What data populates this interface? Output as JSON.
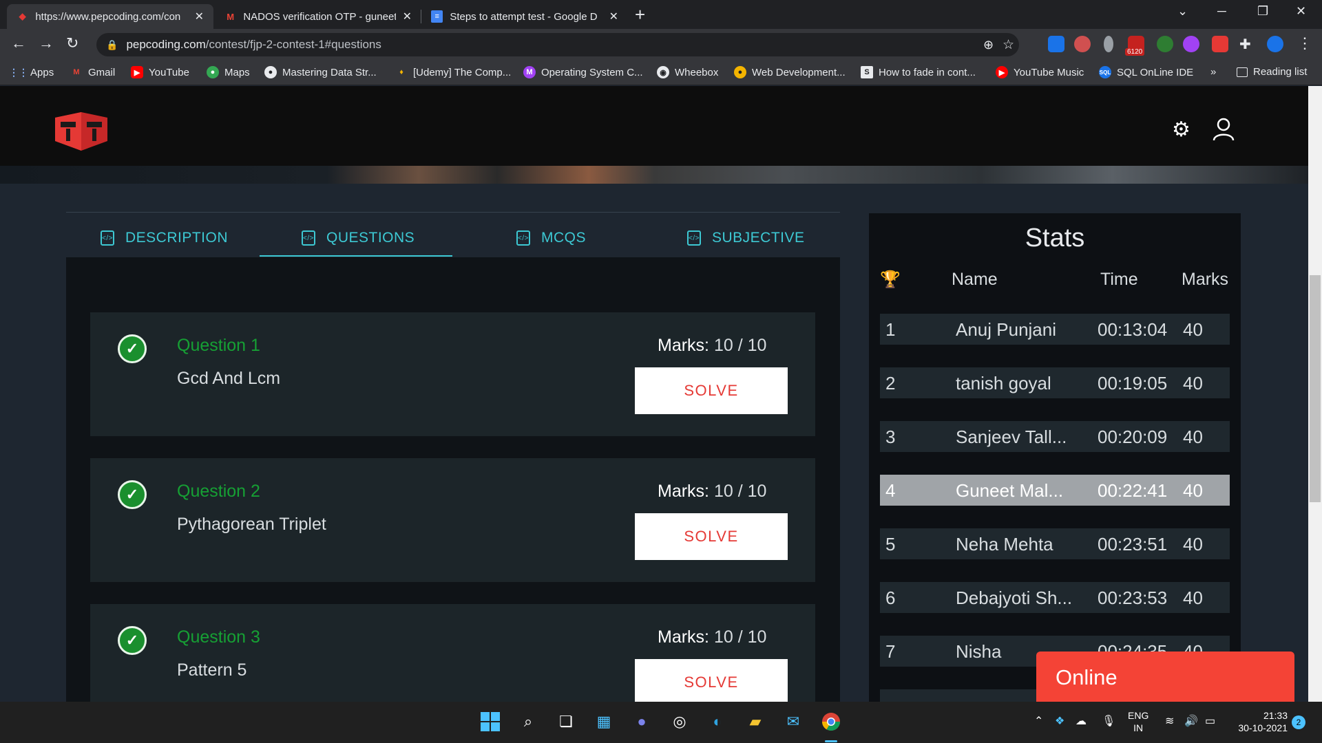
{
  "browser": {
    "tabs": [
      {
        "title": "https://www.pepcoding.com/con",
        "active": true
      },
      {
        "title": "NADOS verification OTP - guneet",
        "active": false
      },
      {
        "title": "Steps to attempt test - Google D",
        "active": false
      }
    ],
    "url_host": "pepcoding.com",
    "url_path": "/contest/fjp-2-contest-1#questions",
    "extension_badge": "6120",
    "bookmarks": [
      "Apps",
      "Gmail",
      "YouTube",
      "Maps",
      "Mastering Data Str...",
      "[Udemy] The Comp...",
      "Operating System C...",
      "Wheebox",
      "Web Development...",
      "How to fade in cont...",
      "YouTube Music",
      "SQL OnLine IDE",
      "»",
      "Reading list"
    ]
  },
  "nav_tabs": [
    "DESCRIPTION",
    "QUESTIONS",
    "MCQS",
    "SUBJECTIVE"
  ],
  "questions": [
    {
      "title": "Question 1",
      "name": "Gcd And Lcm",
      "marks_label": "Marks:",
      "marks": "10 / 10",
      "button": "SOLVE"
    },
    {
      "title": "Question 2",
      "name": "Pythagorean Triplet",
      "marks_label": "Marks:",
      "marks": "10 / 10",
      "button": "SOLVE"
    },
    {
      "title": "Question 3",
      "name": "Pattern 5",
      "marks_label": "Marks:",
      "marks": "10 / 10",
      "button": "SOLVE"
    }
  ],
  "stats": {
    "title": "Stats",
    "headers": {
      "name": "Name",
      "time": "Time",
      "marks": "Marks"
    },
    "rows": [
      {
        "rank": "1",
        "name": "Anuj Punjani",
        "time": "00:13:04",
        "marks": "40",
        "highlight": false
      },
      {
        "rank": "2",
        "name": "tanish goyal",
        "time": "00:19:05",
        "marks": "40",
        "highlight": false
      },
      {
        "rank": "3",
        "name": "Sanjeev Tall...",
        "time": "00:20:09",
        "marks": "40",
        "highlight": false
      },
      {
        "rank": "4",
        "name": "Guneet Mal...",
        "time": "00:22:41",
        "marks": "40",
        "highlight": true
      },
      {
        "rank": "5",
        "name": "Neha Mehta",
        "time": "00:23:51",
        "marks": "40",
        "highlight": false
      },
      {
        "rank": "6",
        "name": "Debajyoti Sh...",
        "time": "00:23:53",
        "marks": "40",
        "highlight": false
      },
      {
        "rank": "7",
        "name": "Nisha",
        "time": "00:24:35",
        "marks": "40",
        "highlight": false
      }
    ]
  },
  "online_label": "Online",
  "taskbar": {
    "lang": "ENG",
    "region": "IN",
    "time": "21:33",
    "date": "30-10-2021",
    "notification_count": "2"
  },
  "colors": {
    "accent": "#3dc9d4",
    "success": "#16a034",
    "danger": "#e53935",
    "online": "#f44336"
  }
}
